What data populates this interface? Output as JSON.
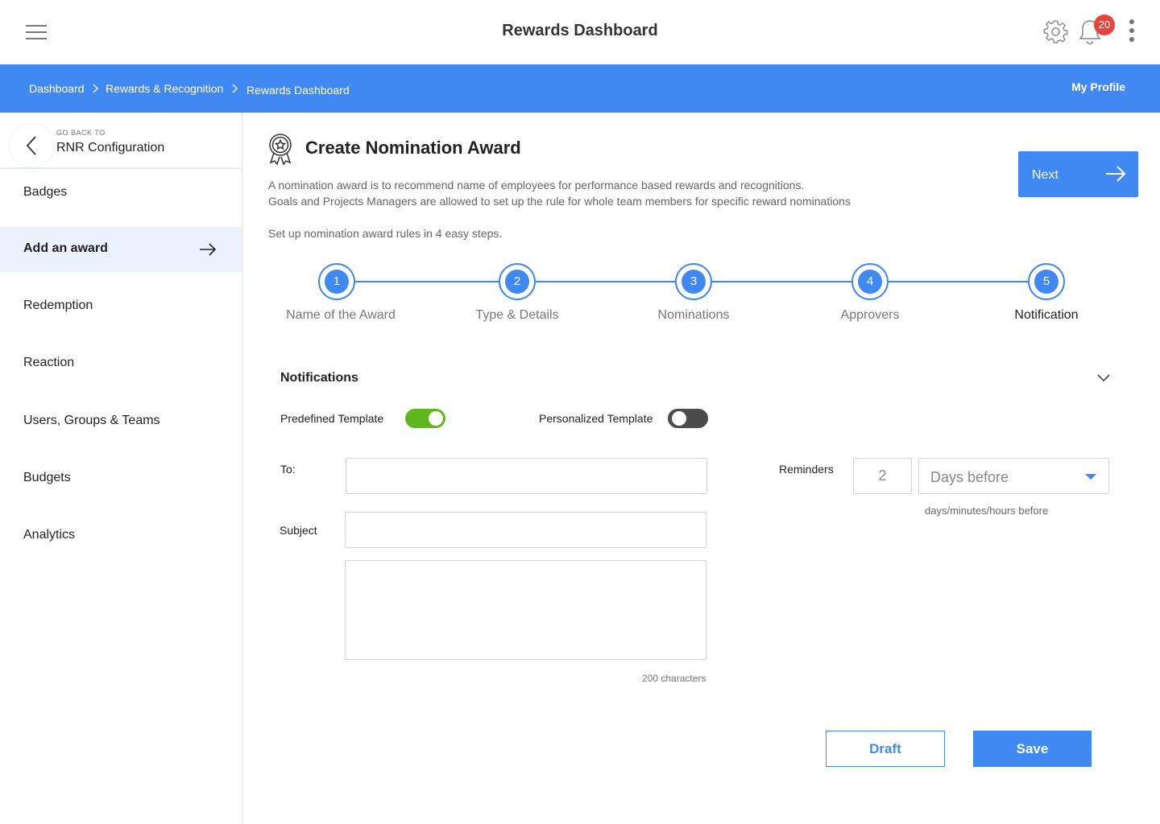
{
  "header": {
    "title": "Rewards Dashboard",
    "notification_count": "20",
    "icons": [
      "menu-icon",
      "gear-icon",
      "bell-icon",
      "kebab-menu-icon"
    ]
  },
  "breadcrumb": {
    "items": [
      "Dashboard",
      "Rewards & Recognition",
      "Rewards Dashboard"
    ],
    "profile_link": "My Profile"
  },
  "sidebar": {
    "go_back_small": "GO BACK TO",
    "go_back_label": "RNR Configuration",
    "items": [
      {
        "label": "Badges",
        "active": false
      },
      {
        "label": "Add an award",
        "active": true
      },
      {
        "label": "Redemption",
        "active": false
      },
      {
        "label": "Reaction",
        "active": false
      },
      {
        "label": "Users, Groups & Teams",
        "active": false
      },
      {
        "label": "Budgets",
        "active": false
      },
      {
        "label": "Analytics",
        "active": false
      }
    ]
  },
  "main": {
    "title": "Create Nomination Award",
    "description_1": "A nomination award is to recommend name of employees for performance based rewards and recognitions.",
    "description_2": "Goals and Projects Managers are allowed to set up the rule for whole team members for specific reward nominations",
    "steps_intro": "Set up nomination award rules in 4 easy steps.",
    "next_label": "Next",
    "steps": [
      {
        "number": "1",
        "label": "Name of the Award"
      },
      {
        "number": "2",
        "label": "Type & Details"
      },
      {
        "number": "3",
        "label": "Nominations"
      },
      {
        "number": "4",
        "label": "Approvers"
      },
      {
        "number": "5",
        "label": "Notification"
      }
    ],
    "current_step": 5
  },
  "notifications": {
    "title": "Notifications",
    "predefined_label": "Predefined Template",
    "predefined_on": true,
    "personalized_label": "Personalized Template",
    "personalized_on": false,
    "to_label": "To:",
    "to_value": "",
    "subject_label": "Subject",
    "subject_value": "",
    "body_value": "",
    "char_count": "200 characters",
    "reminders_label": "Reminders",
    "reminder_value": "2",
    "reminder_unit": "Days before",
    "reminder_hint": "days/minutes/hours before"
  },
  "actions": {
    "draft_label": "Draft",
    "save_label": "Save"
  },
  "colors": {
    "primary": "#4189f2",
    "toggle_on": "#5fb61d",
    "toggle_off": "#4b4b4b",
    "badge": "#e8443a",
    "active_nav_bg": "#e9f2fd"
  }
}
